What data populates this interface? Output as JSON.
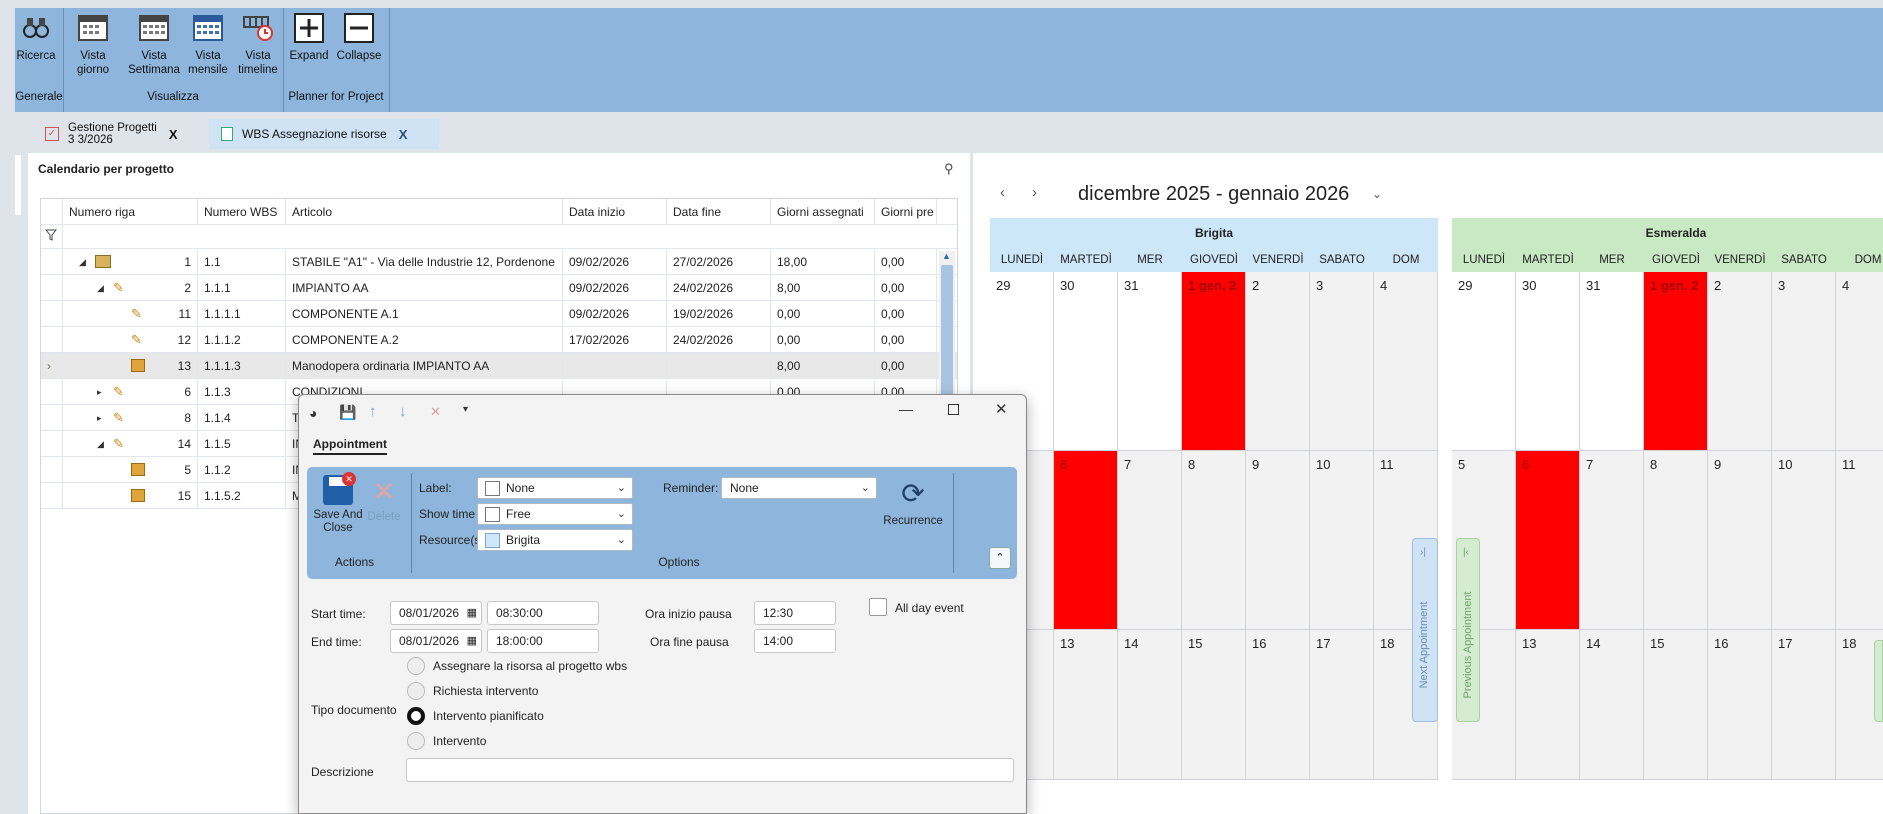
{
  "ribbon": {
    "buttons": [
      {
        "id": "search",
        "label": "Ricerca",
        "icon": "binoculars-icon"
      },
      {
        "id": "day",
        "label": "Vista\ngiorno",
        "icon": "calendar-day-icon"
      },
      {
        "id": "week",
        "label": "Vista\nSettimana",
        "icon": "calendar-week-icon"
      },
      {
        "id": "month",
        "label": "Vista\nmensile",
        "icon": "calendar-month-icon"
      },
      {
        "id": "timeline",
        "label": "Vista\ntimeline",
        "icon": "timeline-icon"
      },
      {
        "id": "expand",
        "label": "Expand",
        "icon": "plus-box-icon"
      },
      {
        "id": "collapse",
        "label": "Collapse",
        "icon": "minus-box-icon"
      }
    ],
    "groups": {
      "generale": "Generale",
      "visualizza": "Visualizza",
      "planner": "Planner for Project"
    }
  },
  "tabs": [
    {
      "label": "Gestione Progetti\n3 3/2026",
      "close": "X",
      "icon": "check-doc-icon"
    },
    {
      "label": "WBS Assegnazione risorse",
      "close": "X",
      "icon": "sheet-icon"
    }
  ],
  "left": {
    "title": "Calendario per progetto",
    "columns": [
      "Numero riga",
      "Numero WBS",
      "Articolo",
      "Data inizio",
      "Data fine",
      "Giorni assegnati",
      "Giorni pre"
    ],
    "rows": [
      {
        "num": "1",
        "wbs": "1.1",
        "art": "STABILE \"A1\" - Via delle Industrie 12, Pordenone",
        "start": "09/02/2026",
        "end": "27/02/2026",
        "days": "18,00",
        "pre": "0,00"
      },
      {
        "num": "2",
        "wbs": "1.1.1",
        "art": "IMPIANTO AA",
        "start": "09/02/2026",
        "end": "24/02/2026",
        "days": "8,00",
        "pre": "0,00"
      },
      {
        "num": "11",
        "wbs": "1.1.1.1",
        "art": "COMPONENTE A.1",
        "start": "09/02/2026",
        "end": "19/02/2026",
        "days": "0,00",
        "pre": "0,00"
      },
      {
        "num": "12",
        "wbs": "1.1.1.2",
        "art": "COMPONENTE A.2",
        "start": "17/02/2026",
        "end": "24/02/2026",
        "days": "0,00",
        "pre": "0,00"
      },
      {
        "num": "13",
        "wbs": "1.1.1.3",
        "art": "Manodopera ordinaria IMPIANTO AA",
        "start": "",
        "end": "",
        "days": "8,00",
        "pre": "0,00"
      },
      {
        "num": "6",
        "wbs": "1.1.3",
        "art": "CONDIZIONI",
        "start": "",
        "end": "",
        "days": "0,00",
        "pre": "0,00"
      },
      {
        "num": "8",
        "wbs": "1.1.4",
        "art": "T",
        "start": "",
        "end": "",
        "days": "",
        "pre": ""
      },
      {
        "num": "14",
        "wbs": "1.1.5",
        "art": "IN",
        "start": "",
        "end": "",
        "days": "",
        "pre": ""
      },
      {
        "num": "5",
        "wbs": "1.1.2",
        "art": "IN",
        "start": "",
        "end": "",
        "days": "",
        "pre": ""
      },
      {
        "num": "15",
        "wbs": "1.1.5.2",
        "art": "M",
        "start": "",
        "end": "",
        "days": "",
        "pre": ""
      }
    ]
  },
  "calendar": {
    "title": "dicembre 2025 - gennaio 2026",
    "resources": [
      {
        "name": "Brigita",
        "color": "#cde6f8"
      },
      {
        "name": "Esmeralda",
        "color": "#c9e8c4"
      }
    ],
    "days": [
      "LUNEDÌ",
      "MARTEDÌ",
      "MER",
      "GIOVEDÌ",
      "VENERDÌ",
      "SABATO",
      "DOM"
    ],
    "weeks": [
      [
        "29",
        "30",
        "31",
        "1 gen, 2",
        "2",
        "3",
        "4"
      ],
      [
        "5",
        "6",
        "7",
        "8",
        "9",
        "10",
        "11"
      ],
      [
        "12",
        "13",
        "14",
        "15",
        "16",
        "17",
        "18"
      ]
    ],
    "next": "Next Appointment",
    "prev": "Previous Appointment"
  },
  "dialog": {
    "tab": "Appointment",
    "save": "Save And\nClose",
    "delete": "Delete",
    "recurrence": "Recurrence",
    "actions": "Actions",
    "options": "Options",
    "label_lbl": "Label:",
    "label_val": "None",
    "show_lbl": "Show time as:",
    "show_val": "Free",
    "res_lbl": "Resource(s):",
    "res_val": "Brigita",
    "rem_lbl": "Reminder:",
    "rem_val": "None",
    "start_lbl": "Start time:",
    "start_date": "08/01/2026",
    "start_time": "08:30:00",
    "end_lbl": "End time:",
    "end_date": "08/01/2026",
    "end_time": "18:00:00",
    "pause_start_lbl": "Ora inizio pausa",
    "pause_start": "12:30",
    "pause_end_lbl": "Ora fine pausa",
    "pause_end": "14:00",
    "allday": "All day event",
    "tipo": "Tipo documento",
    "options_list": [
      "Assegnare la risorsa al progetto wbs",
      "Richiesta intervento",
      "Intervento pianificato",
      "Intervento"
    ],
    "selected": 2,
    "descr": "Descrizione"
  }
}
